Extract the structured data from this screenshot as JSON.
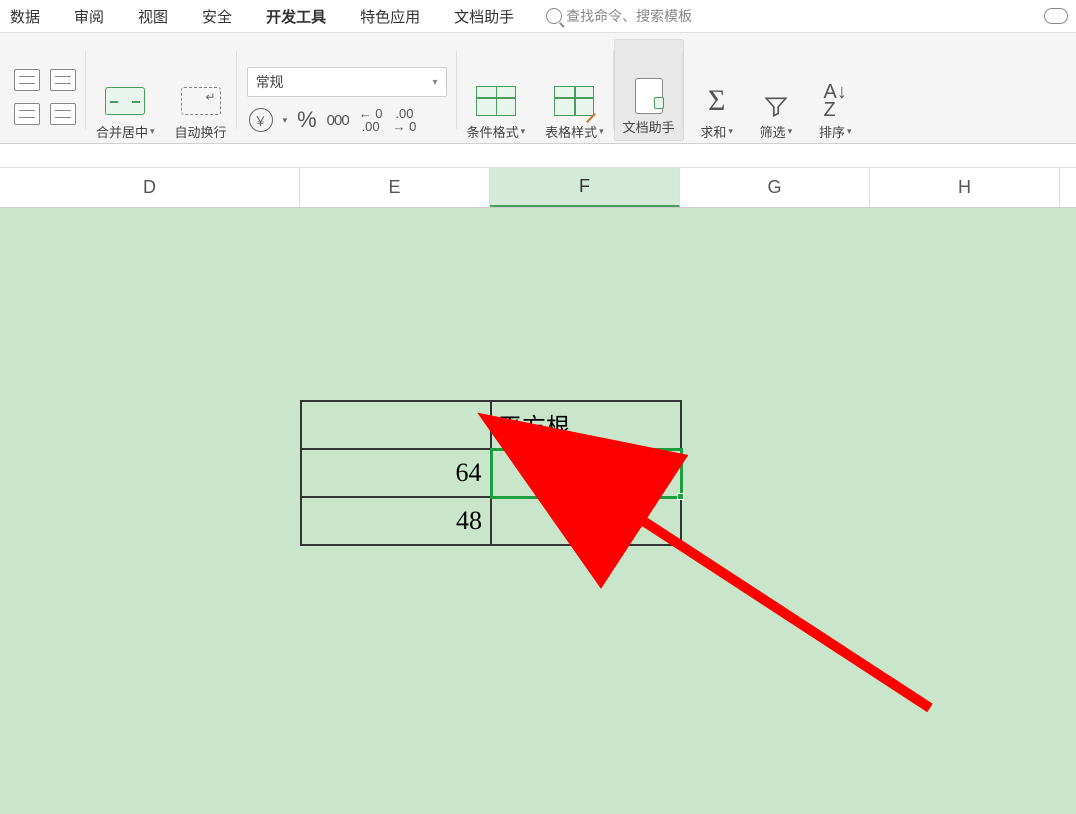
{
  "menu": {
    "items": [
      "数据",
      "审阅",
      "视图",
      "安全",
      "开发工具",
      "特色应用",
      "文档助手"
    ],
    "search_placeholder": "查找命令、搜索模板"
  },
  "ribbon": {
    "merge_center": "合并居中",
    "wrap_text": "自动换行",
    "number_format": "常规",
    "currency_symbol": "￥",
    "percent_symbol": "%",
    "thousands_sep": "000",
    "dec_inc_top": "← 0",
    "dec_inc_bot": ".00",
    "dec_dec_top": ".00",
    "dec_dec_bot": "→ 0",
    "cond_format": "条件格式",
    "table_style": "表格样式",
    "doc_helper": "文档助手",
    "sum": "求和",
    "filter": "筛选",
    "sort": "排序",
    "sigma": "Σ",
    "sort_glyph": "A↓\nZ"
  },
  "columns": {
    "d": "D",
    "e": "E",
    "f": "F",
    "g": "G",
    "h": "H"
  },
  "table": {
    "header_col2": "平方根",
    "row1_val": "64",
    "row2_val": "48"
  }
}
